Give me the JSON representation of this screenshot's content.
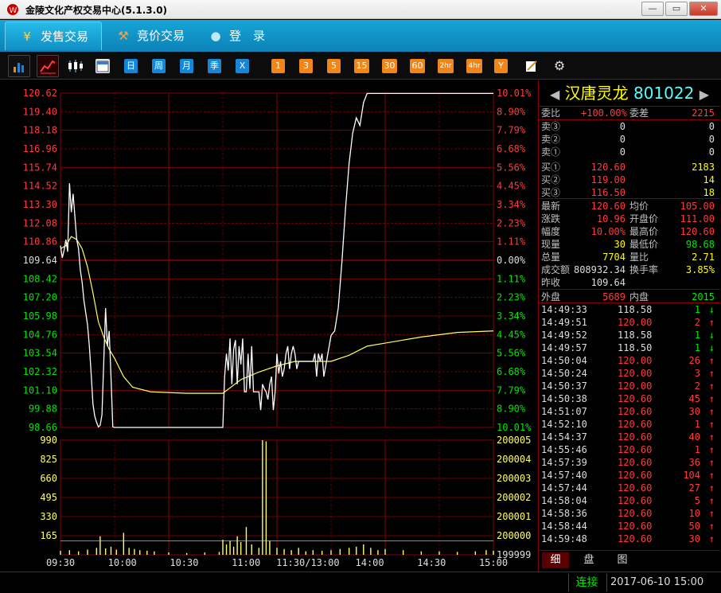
{
  "window": {
    "title": "金陵文化产权交易中心(5.1.3.0)",
    "controls": [
      "—",
      "▭",
      "✕"
    ]
  },
  "nav": {
    "tabs": [
      {
        "label": "发售交易",
        "icon": "yen-icon"
      },
      {
        "label": "竞价交易",
        "icon": "gavel-icon"
      },
      {
        "label": "登　录",
        "icon": "user-icon"
      }
    ]
  },
  "toolbar": {
    "period_buttons": [
      "日",
      "周",
      "月",
      "季",
      "X"
    ],
    "minute_buttons": [
      "1",
      "3",
      "5",
      "15",
      "30",
      "60",
      "2hr",
      "4hr",
      "Y"
    ]
  },
  "stock": {
    "name": "汉唐灵龙",
    "code": "801022",
    "weibi_label": "委比",
    "weibi_value": "+100.00%",
    "weicha_label": "委差",
    "weicha_value": "2215",
    "sells": [
      {
        "label": "卖③",
        "price": "0",
        "vol": "0"
      },
      {
        "label": "卖②",
        "price": "0",
        "vol": "0"
      },
      {
        "label": "卖①",
        "price": "0",
        "vol": "0"
      }
    ],
    "buys": [
      {
        "label": "买①",
        "price": "120.60",
        "vol": "2183"
      },
      {
        "label": "买②",
        "price": "119.00",
        "vol": "14"
      },
      {
        "label": "买③",
        "price": "116.50",
        "vol": "18"
      }
    ],
    "quote": [
      {
        "l1": "最新",
        "v1": "120.60",
        "l2": "均价",
        "v2": "105.00"
      },
      {
        "l1": "涨跌",
        "v1": "10.96",
        "l2": "开盘价",
        "v2": "111.00"
      },
      {
        "l1": "幅度",
        "v1": "10.00%",
        "l2": "最高价",
        "v2": "120.60"
      },
      {
        "l1": "现量",
        "v1": "30",
        "l2": "最低价",
        "v2": "98.68"
      },
      {
        "l1": "总量",
        "v1": "7704",
        "l2": "量比",
        "v2": "2.71"
      },
      {
        "l1": "成交额",
        "v1": "808932.34",
        "l2": "换手率",
        "v2": "3.85%"
      },
      {
        "l1": "昨收",
        "v1": "109.64",
        "l2": "",
        "v2": ""
      }
    ],
    "waipan_label": "外盘",
    "waipan_value": "5689",
    "neipan_label": "内盘",
    "neipan_value": "2015"
  },
  "trades": [
    {
      "time": "14:49:33",
      "price": "118.58",
      "vol": "1",
      "dir": "↓"
    },
    {
      "time": "14:49:51",
      "price": "120.00",
      "vol": "2",
      "dir": "↑"
    },
    {
      "time": "14:49:52",
      "price": "118.58",
      "vol": "1",
      "dir": "↓"
    },
    {
      "time": "14:49:57",
      "price": "118.50",
      "vol": "1",
      "dir": "↓"
    },
    {
      "time": "14:50:04",
      "price": "120.00",
      "vol": "26",
      "dir": "↑"
    },
    {
      "time": "14:50:24",
      "price": "120.00",
      "vol": "3",
      "dir": "↑"
    },
    {
      "time": "14:50:37",
      "price": "120.00",
      "vol": "2",
      "dir": "↑"
    },
    {
      "time": "14:50:38",
      "price": "120.60",
      "vol": "45",
      "dir": "↑"
    },
    {
      "time": "14:51:07",
      "price": "120.60",
      "vol": "30",
      "dir": "↑"
    },
    {
      "time": "14:52:10",
      "price": "120.60",
      "vol": "1",
      "dir": "↑"
    },
    {
      "time": "14:54:37",
      "price": "120.60",
      "vol": "40",
      "dir": "↑"
    },
    {
      "time": "14:55:46",
      "price": "120.60",
      "vol": "1",
      "dir": "↑"
    },
    {
      "time": "14:57:39",
      "price": "120.60",
      "vol": "36",
      "dir": "↑"
    },
    {
      "time": "14:57:40",
      "price": "120.60",
      "vol": "104",
      "dir": "↑"
    },
    {
      "time": "14:57:44",
      "price": "120.60",
      "vol": "27",
      "dir": "↑"
    },
    {
      "time": "14:58:04",
      "price": "120.60",
      "vol": "5",
      "dir": "↑"
    },
    {
      "time": "14:58:36",
      "price": "120.60",
      "vol": "10",
      "dir": "↑"
    },
    {
      "time": "14:58:44",
      "price": "120.60",
      "vol": "50",
      "dir": "↑"
    },
    {
      "time": "14:59:48",
      "price": "120.60",
      "vol": "30",
      "dir": "↑"
    }
  ],
  "panel_tabs": [
    "细",
    "盘",
    "图"
  ],
  "status": {
    "connection": "连接",
    "datetime": "2017-06-10 15:00"
  },
  "colors": {
    "up": "#ff3b3b",
    "down": "#00e600",
    "grid": "#8a0000",
    "avg_line": "#ffff66",
    "price_line": "#ffffff"
  },
  "chart_data": {
    "type": "line",
    "price_ticks": [
      "120.62",
      "119.40",
      "118.18",
      "116.96",
      "115.74",
      "114.52",
      "113.30",
      "112.08",
      "110.86",
      "109.64",
      "108.42",
      "107.20",
      "105.98",
      "104.76",
      "103.54",
      "102.32",
      "101.10",
      "99.88",
      "98.66"
    ],
    "pct_ticks": [
      "10.01%",
      "8.90%",
      "7.79%",
      "6.68%",
      "5.56%",
      "4.45%",
      "3.34%",
      "2.23%",
      "1.11%",
      "0.00%",
      "1.11%",
      "2.23%",
      "3.34%",
      "4.45%",
      "5.56%",
      "6.68%",
      "7.79%",
      "8.90%",
      "10.01%"
    ],
    "volume_ticks": [
      "990",
      "825",
      "660",
      "495",
      "330",
      "165"
    ],
    "volume_right_ticks": [
      "200005",
      "200004",
      "200003",
      "200002",
      "200001",
      "200000",
      "199999"
    ],
    "time_ticks": [
      "09:30",
      "10:00",
      "10:30",
      "11:00",
      "11:30/13:00",
      "14:00",
      "14:30",
      "15:00"
    ],
    "ylim": [
      98.66,
      120.62
    ],
    "prev_close": 109.64,
    "total_minutes": 240,
    "price": [
      [
        0,
        110.6
      ],
      [
        1,
        109.8
      ],
      [
        2,
        110.3
      ],
      [
        3,
        111.0
      ],
      [
        4,
        110.2
      ],
      [
        5,
        114.7
      ],
      [
        6,
        112.8
      ],
      [
        7,
        114.0
      ],
      [
        8,
        112.5
      ],
      [
        9,
        111.0
      ],
      [
        10,
        110.4
      ],
      [
        11,
        109.0
      ],
      [
        12,
        108.2
      ],
      [
        13,
        107.0
      ],
      [
        14,
        106.2
      ],
      [
        15,
        105.4
      ],
      [
        16,
        104.0
      ],
      [
        17,
        102.2
      ],
      [
        18,
        100.2
      ],
      [
        19,
        99.4
      ],
      [
        20,
        99.0
      ],
      [
        21,
        98.7
      ],
      [
        22,
        98.8
      ],
      [
        23,
        99.5
      ],
      [
        24,
        103.0
      ],
      [
        25,
        106.5
      ],
      [
        26,
        104.0
      ],
      [
        27,
        105.0
      ],
      [
        28,
        102.0
      ],
      [
        29,
        98.7
      ],
      [
        30,
        98.66
      ],
      [
        40,
        98.66
      ],
      [
        60,
        98.66
      ],
      [
        80,
        98.66
      ],
      [
        90,
        98.66
      ],
      [
        91,
        102.0
      ],
      [
        92,
        103.5
      ],
      [
        93,
        102.4
      ],
      [
        94,
        104.5
      ],
      [
        95,
        101.5
      ],
      [
        96,
        103.8
      ],
      [
        97,
        104.4
      ],
      [
        98,
        101.5
      ],
      [
        99,
        104.0
      ],
      [
        100,
        102.8
      ],
      [
        101,
        104.5
      ],
      [
        102,
        101.0
      ],
      [
        103,
        101.0
      ],
      [
        104,
        103.5
      ],
      [
        105,
        101.2
      ],
      [
        106,
        104.0
      ],
      [
        107,
        101.0
      ],
      [
        108,
        101.0
      ],
      [
        109,
        101.0
      ],
      [
        110,
        101.0
      ],
      [
        111,
        99.8
      ],
      [
        112,
        101.5
      ],
      [
        113,
        101.2
      ],
      [
        114,
        101.0
      ],
      [
        115,
        100.5
      ],
      [
        116,
        101.5
      ],
      [
        117,
        102.0
      ],
      [
        118,
        99.8
      ],
      [
        119,
        101.0
      ],
      [
        120,
        103.5
      ],
      [
        121,
        102.2
      ],
      [
        122,
        103.0
      ],
      [
        123,
        102.0
      ],
      [
        124,
        102.5
      ],
      [
        125,
        103.5
      ],
      [
        126,
        104.0
      ],
      [
        127,
        102.5
      ],
      [
        128,
        103.5
      ],
      [
        129,
        104.0
      ],
      [
        130,
        103.5
      ],
      [
        131,
        102.5
      ],
      [
        132,
        103.0
      ],
      [
        135,
        103.0
      ],
      [
        140,
        103.0
      ],
      [
        141,
        103.5
      ],
      [
        142,
        102.0
      ],
      [
        143,
        103.5
      ],
      [
        144,
        103.0
      ],
      [
        145,
        103.5
      ],
      [
        146,
        102.0
      ],
      [
        150,
        104.7
      ],
      [
        152,
        105.0
      ],
      [
        154,
        106.5
      ],
      [
        156,
        109.5
      ],
      [
        158,
        113.0
      ],
      [
        160,
        116.0
      ],
      [
        162,
        118.0
      ],
      [
        164,
        119.0
      ],
      [
        166,
        118.5
      ],
      [
        168,
        120.0
      ],
      [
        170,
        120.6
      ],
      [
        240,
        120.6
      ]
    ],
    "avg": [
      [
        0,
        110.4
      ],
      [
        3,
        110.6
      ],
      [
        6,
        111.2
      ],
      [
        9,
        111.0
      ],
      [
        12,
        110.4
      ],
      [
        15,
        109.2
      ],
      [
        18,
        107.5
      ],
      [
        21,
        105.6
      ],
      [
        24,
        104.6
      ],
      [
        27,
        103.8
      ],
      [
        30,
        103.2
      ],
      [
        35,
        102.0
      ],
      [
        40,
        101.3
      ],
      [
        50,
        101.0
      ],
      [
        70,
        100.9
      ],
      [
        90,
        100.9
      ],
      [
        100,
        101.8
      ],
      [
        110,
        102.3
      ],
      [
        120,
        102.7
      ],
      [
        130,
        103.0
      ],
      [
        150,
        103.0
      ],
      [
        160,
        103.4
      ],
      [
        170,
        104.0
      ],
      [
        180,
        104.2
      ],
      [
        200,
        104.6
      ],
      [
        220,
        104.9
      ],
      [
        240,
        105.0
      ]
    ],
    "volume_max": 990,
    "volume_ref_line": 120,
    "volume": [
      [
        0,
        35
      ],
      [
        5,
        40
      ],
      [
        10,
        30
      ],
      [
        15,
        45
      ],
      [
        20,
        60
      ],
      [
        22,
        160
      ],
      [
        25,
        55
      ],
      [
        28,
        70
      ],
      [
        31,
        45
      ],
      [
        35,
        190
      ],
      [
        38,
        60
      ],
      [
        41,
        50
      ],
      [
        44,
        40
      ],
      [
        48,
        35
      ],
      [
        52,
        30
      ],
      [
        60,
        20
      ],
      [
        70,
        15
      ],
      [
        80,
        20
      ],
      [
        88,
        25
      ],
      [
        90,
        130
      ],
      [
        92,
        90
      ],
      [
        94,
        120
      ],
      [
        96,
        70
      ],
      [
        98,
        160
      ],
      [
        100,
        110
      ],
      [
        103,
        240
      ],
      [
        106,
        90
      ],
      [
        110,
        60
      ],
      [
        112,
        990
      ],
      [
        114,
        980
      ],
      [
        116,
        120
      ],
      [
        120,
        60
      ],
      [
        124,
        50
      ],
      [
        128,
        40
      ],
      [
        132,
        60
      ],
      [
        136,
        30
      ],
      [
        140,
        40
      ],
      [
        145,
        35
      ],
      [
        150,
        40
      ],
      [
        155,
        50
      ],
      [
        160,
        60
      ],
      [
        164,
        70
      ],
      [
        168,
        90
      ],
      [
        172,
        60
      ],
      [
        176,
        40
      ],
      [
        180,
        50
      ],
      [
        190,
        40
      ],
      [
        200,
        30
      ],
      [
        210,
        30
      ],
      [
        220,
        25
      ],
      [
        230,
        30
      ],
      [
        236,
        40
      ],
      [
        240,
        35
      ]
    ]
  }
}
